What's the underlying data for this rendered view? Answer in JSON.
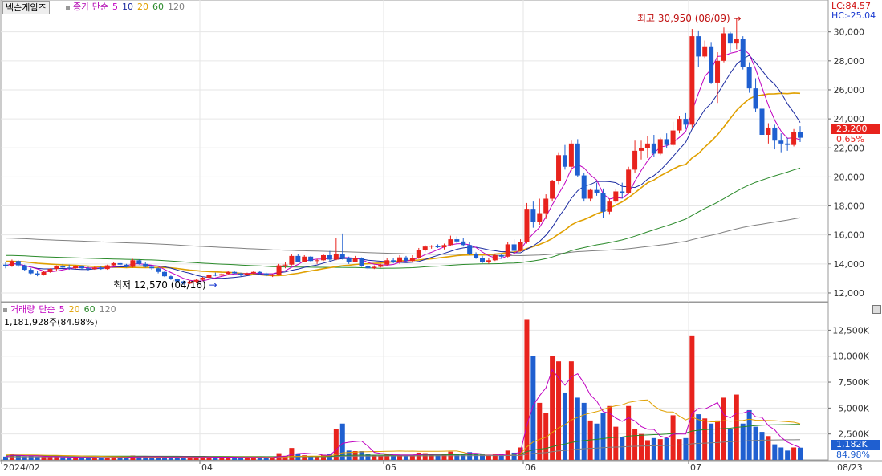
{
  "price_panel": {
    "stock_name": "넥슨게임즈",
    "legend": [
      {
        "text": "종가 단순",
        "color": "#b000b0"
      },
      {
        "text": "5",
        "color": "#c000c0"
      },
      {
        "text": "10",
        "color": "#1a2aa0"
      },
      {
        "text": "20",
        "color": "#e0a000"
      },
      {
        "text": "60",
        "color": "#2a8a2a"
      },
      {
        "text": "120",
        "color": "#808080"
      }
    ],
    "lc_label": "LC:84.57",
    "hc_label": "HC:-25.04",
    "current_price": "23,200",
    "change_pct": "0.65%",
    "high_annotation": "최고 30,950 (08/09)",
    "low_annotation": "최저 12,570 (04/16)",
    "y_ticks": [
      "30,000",
      "28,000",
      "26,000",
      "24,000",
      "22,000",
      "20,000",
      "18,000",
      "16,000",
      "14,000",
      "12,000"
    ]
  },
  "volume_panel": {
    "legend": [
      {
        "text": "거래량",
        "color": "#c000c0"
      },
      {
        "text": "단순",
        "color": "#c000c0"
      },
      {
        "text": "5",
        "color": "#c000c0"
      },
      {
        "text": "20",
        "color": "#e0a000"
      },
      {
        "text": "60",
        "color": "#2a8a2a"
      },
      {
        "text": "120",
        "color": "#808080"
      }
    ],
    "last_volume_text": "1,181,928주(84.98%)",
    "current_volume": "1,182K",
    "current_pct": "84.98%",
    "y_ticks": [
      "12,500K",
      "10,000K",
      "7,500K",
      "5,000K",
      "2,500K"
    ]
  },
  "x_axis": [
    "2024/02",
    "04",
    "05",
    "06",
    "07",
    "08",
    "08/23"
  ],
  "colors": {
    "up": "#e8231d",
    "down": "#1f5fd0",
    "grid": "#e6e6e6",
    "price_tag": "#e8231d",
    "volume_tag": "#1f5fd0"
  },
  "chart_data": {
    "type": "candlestick",
    "title": "넥슨게임즈",
    "price_axis": {
      "min": 12000,
      "max": 30000,
      "unit": "KRW"
    },
    "volume_axis": {
      "min": 0,
      "max": 12500,
      "unit": "K shares"
    },
    "candles_ohlcv": [
      [
        13950,
        14100,
        13700,
        13850,
        320
      ],
      [
        13850,
        14300,
        13800,
        14200,
        600
      ],
      [
        14200,
        14250,
        13800,
        13900,
        400
      ],
      [
        13900,
        13950,
        13500,
        13600,
        350
      ],
      [
        13600,
        13700,
        13300,
        13350,
        380
      ],
      [
        13350,
        13500,
        13150,
        13250,
        330
      ],
      [
        13250,
        13500,
        13200,
        13450,
        300
      ],
      [
        13450,
        13700,
        13400,
        13650,
        310
      ],
      [
        13650,
        13900,
        13550,
        13850,
        290
      ],
      [
        13850,
        14000,
        13700,
        13750,
        260
      ],
      [
        13750,
        13950,
        13600,
        13700,
        250
      ],
      [
        13700,
        13900,
        13650,
        13850,
        240
      ],
      [
        13850,
        13900,
        13650,
        13700,
        230
      ],
      [
        13700,
        13800,
        13550,
        13650,
        220
      ],
      [
        13650,
        13800,
        13600,
        13750,
        210
      ],
      [
        13750,
        13850,
        13600,
        13650,
        200
      ],
      [
        13650,
        13950,
        13600,
        13900,
        230
      ],
      [
        13900,
        14100,
        13850,
        14050,
        260
      ],
      [
        14050,
        14150,
        13900,
        13950,
        250
      ],
      [
        13950,
        14000,
        13750,
        13800,
        240
      ],
      [
        13800,
        14350,
        13750,
        14250,
        420
      ],
      [
        14250,
        14300,
        13950,
        14000,
        340
      ],
      [
        14000,
        14100,
        13750,
        13800,
        280
      ],
      [
        13800,
        13900,
        13600,
        13700,
        250
      ],
      [
        13700,
        13750,
        13350,
        13450,
        300
      ],
      [
        13450,
        13500,
        13100,
        13150,
        310
      ],
      [
        13150,
        13200,
        12900,
        12950,
        290
      ],
      [
        12950,
        13000,
        12700,
        12800,
        300
      ],
      [
        12800,
        12850,
        12570,
        12650,
        330
      ],
      [
        12650,
        12850,
        12600,
        12780,
        280
      ],
      [
        12780,
        12950,
        12700,
        12900,
        260
      ],
      [
        12900,
        13100,
        12850,
        13050,
        270
      ],
      [
        13050,
        13300,
        13000,
        13250,
        300
      ],
      [
        13250,
        13400,
        13150,
        13200,
        260
      ],
      [
        13200,
        13350,
        13150,
        13300,
        250
      ],
      [
        13300,
        13500,
        13250,
        13450,
        280
      ],
      [
        13450,
        13550,
        13300,
        13350,
        260
      ],
      [
        13350,
        13400,
        13150,
        13250,
        240
      ],
      [
        13250,
        13400,
        13200,
        13350,
        230
      ],
      [
        13350,
        13500,
        13300,
        13450,
        250
      ],
      [
        13450,
        13500,
        13250,
        13350,
        230
      ],
      [
        13350,
        13400,
        13150,
        13200,
        220
      ],
      [
        13200,
        13300,
        13100,
        13250,
        240
      ],
      [
        13250,
        14000,
        13200,
        13900,
        650
      ],
      [
        13900,
        14100,
        13700,
        13950,
        400
      ],
      [
        13950,
        14650,
        13900,
        14550,
        1150
      ],
      [
        14550,
        14700,
        14100,
        14150,
        600
      ],
      [
        14150,
        14600,
        14100,
        14500,
        450
      ],
      [
        14500,
        14550,
        14100,
        14200,
        380
      ],
      [
        14200,
        14350,
        14000,
        14250,
        350
      ],
      [
        14250,
        14700,
        14200,
        14600,
        500
      ],
      [
        14600,
        14900,
        14200,
        14300,
        600
      ],
      [
        14300,
        15800,
        14250,
        14700,
        3000
      ],
      [
        14700,
        16100,
        14300,
        14400,
        3500
      ],
      [
        14400,
        14500,
        14000,
        14150,
        900
      ],
      [
        14150,
        14550,
        14100,
        14400,
        850
      ],
      [
        14400,
        14450,
        13800,
        13850,
        850
      ],
      [
        13850,
        13950,
        13600,
        13700,
        600
      ],
      [
        13700,
        13900,
        13650,
        13800,
        450
      ],
      [
        13800,
        14000,
        13750,
        13950,
        400
      ],
      [
        13950,
        14400,
        13900,
        14250,
        600
      ],
      [
        14250,
        14400,
        14050,
        14100,
        450
      ],
      [
        14100,
        14600,
        14000,
        14450,
        500
      ],
      [
        14450,
        14550,
        14100,
        14200,
        400
      ],
      [
        14200,
        14600,
        14150,
        14400,
        450
      ],
      [
        14400,
        15100,
        14350,
        14950,
        700
      ],
      [
        14950,
        15300,
        14850,
        15200,
        650
      ],
      [
        15200,
        15300,
        15050,
        15250,
        500
      ],
      [
        15250,
        15350,
        15100,
        15150,
        450
      ],
      [
        15150,
        15400,
        15000,
        15300,
        550
      ],
      [
        15300,
        15950,
        15250,
        15700,
        800
      ],
      [
        15700,
        15900,
        15400,
        15550,
        600
      ],
      [
        15550,
        15800,
        15200,
        15300,
        500
      ],
      [
        15300,
        15500,
        14600,
        14700,
        750
      ],
      [
        14700,
        14800,
        14350,
        14400,
        550
      ],
      [
        14400,
        14550,
        14050,
        14150,
        500
      ],
      [
        14150,
        14400,
        14000,
        14250,
        450
      ],
      [
        14250,
        14700,
        14200,
        14600,
        500
      ],
      [
        14600,
        14700,
        14350,
        14500,
        450
      ],
      [
        14500,
        15500,
        14450,
        15350,
        900
      ],
      [
        15350,
        15700,
        14800,
        14900,
        700
      ],
      [
        14900,
        15700,
        14850,
        15500,
        1200
      ],
      [
        15500,
        18200,
        15400,
        17800,
        13500
      ],
      [
        17800,
        18300,
        16500,
        16900,
        10000
      ],
      [
        16900,
        18500,
        16700,
        17500,
        5500
      ],
      [
        17500,
        18800,
        17100,
        18500,
        4500
      ],
      [
        18500,
        19800,
        18300,
        19700,
        10000
      ],
      [
        19700,
        21700,
        19500,
        21500,
        9500
      ],
      [
        21500,
        22200,
        20500,
        20700,
        6500
      ],
      [
        20700,
        22500,
        20400,
        22300,
        9500
      ],
      [
        22300,
        22600,
        20000,
        20100,
        6000
      ],
      [
        20100,
        20300,
        18300,
        18500,
        5500
      ],
      [
        18500,
        19200,
        18300,
        19100,
        3800
      ],
      [
        19100,
        19600,
        18700,
        18900,
        3500
      ],
      [
        18900,
        19200,
        17200,
        17600,
        4500
      ],
      [
        17600,
        18500,
        17400,
        18300,
        5200
      ],
      [
        18300,
        19200,
        18200,
        19000,
        3200
      ],
      [
        19000,
        19600,
        18500,
        18900,
        2200
      ],
      [
        18900,
        20700,
        18800,
        20500,
        5200
      ],
      [
        20500,
        22500,
        20300,
        21800,
        3000
      ],
      [
        21800,
        22500,
        21200,
        22000,
        2500
      ],
      [
        22000,
        22800,
        21300,
        22300,
        1900
      ],
      [
        22300,
        22900,
        21400,
        21600,
        2100
      ],
      [
        21600,
        22700,
        21500,
        22600,
        2000
      ],
      [
        22600,
        23000,
        22000,
        22200,
        2100
      ],
      [
        22200,
        23800,
        22100,
        23200,
        4300
      ],
      [
        23200,
        24200,
        23000,
        24000,
        2000
      ],
      [
        24000,
        24400,
        23300,
        23600,
        2100
      ],
      [
        23600,
        30200,
        23400,
        29700,
        12000
      ],
      [
        29700,
        30100,
        27600,
        28300,
        4400
      ],
      [
        28300,
        29400,
        28200,
        29000,
        4000
      ],
      [
        29000,
        29300,
        26400,
        26500,
        3500
      ],
      [
        26500,
        28600,
        25100,
        28000,
        3800
      ],
      [
        28000,
        30300,
        27900,
        29900,
        6000
      ],
      [
        29900,
        30000,
        28600,
        29200,
        3000
      ],
      [
        29200,
        30950,
        28800,
        29500,
        6300
      ],
      [
        29500,
        29700,
        27400,
        27600,
        3500
      ],
      [
        27600,
        27900,
        25800,
        26100,
        4800
      ],
      [
        26100,
        26800,
        24500,
        24700,
        3200
      ],
      [
        24700,
        25300,
        22800,
        22900,
        2700
      ],
      [
        22900,
        23700,
        22300,
        23400,
        2300
      ],
      [
        23400,
        23600,
        21900,
        22500,
        1500
      ],
      [
        22500,
        23000,
        21700,
        22300,
        1200
      ],
      [
        22300,
        22700,
        21800,
        22200,
        900
      ],
      [
        22200,
        23300,
        22100,
        23100,
        1200
      ],
      [
        23100,
        23500,
        22400,
        22700,
        1182
      ]
    ]
  }
}
